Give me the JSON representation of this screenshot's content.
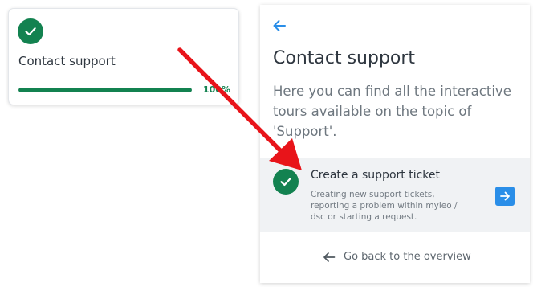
{
  "tour_card": {
    "title": "Contact support",
    "progress_percent": 100,
    "progress_label": "100%",
    "icon": "check-icon"
  },
  "panel": {
    "back_icon": "arrow-left-icon",
    "title": "Contact support",
    "description": "Here you can find all the interactive tours available on the topic of 'Support'.",
    "tour_item": {
      "title": "Create a support ticket",
      "description": "Creating new support tickets, reporting a problem within myleo / dsc or starting a request.",
      "status_icon": "check-icon",
      "action_icon": "arrow-right-icon"
    },
    "back_link": {
      "label": "Go back to the overview",
      "icon": "arrow-left-icon"
    }
  },
  "annotation": {
    "icon": "red-arrow",
    "color": "#e8141a"
  },
  "colors": {
    "success": "#138250",
    "accent": "#2a8ee8",
    "item_background": "#f0f2f4"
  }
}
